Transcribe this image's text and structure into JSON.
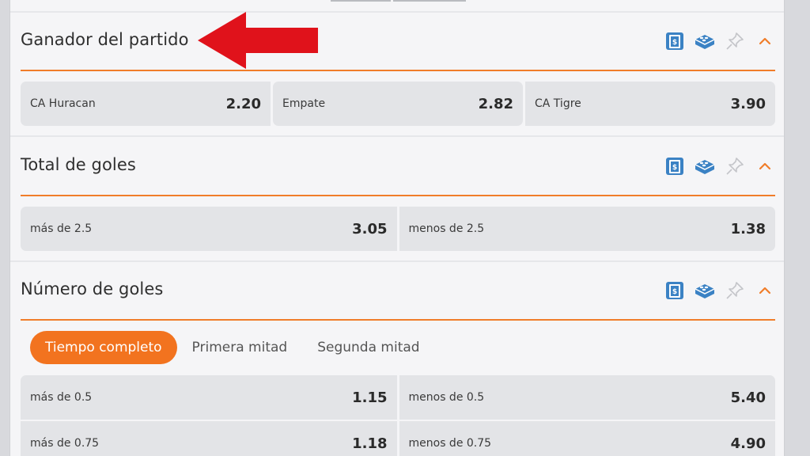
{
  "colors": {
    "accent": "#f07d2a",
    "tab_active_bg": "#f2731f",
    "icon_blue": "#3b82c4",
    "annotation_arrow": "#e0121b"
  },
  "markets": [
    {
      "title": "Ganador del partido",
      "icons": [
        "cashout-icon",
        "bet-builder-icon",
        "pin-icon",
        "chevron-up-icon"
      ],
      "rows": [
        [
          {
            "label": "CA Huracan",
            "value": "2.20"
          },
          {
            "label": "Empate",
            "value": "2.82"
          },
          {
            "label": "CA Tigre",
            "value": "3.90"
          }
        ]
      ]
    },
    {
      "title": "Total de goles",
      "icons": [
        "cashout-icon",
        "bet-builder-icon",
        "pin-icon",
        "chevron-up-icon"
      ],
      "rows": [
        [
          {
            "label": "más de 2.5",
            "value": "3.05"
          },
          {
            "label": "menos de 2.5",
            "value": "1.38"
          }
        ]
      ]
    },
    {
      "title": "Número de goles",
      "icons": [
        "cashout-icon",
        "bet-builder-icon",
        "pin-icon",
        "chevron-up-icon"
      ],
      "tabs": [
        {
          "label": "Tiempo completo",
          "active": true
        },
        {
          "label": "Primera mitad",
          "active": false
        },
        {
          "label": "Segunda mitad",
          "active": false
        }
      ],
      "rows": [
        [
          {
            "label": "más de 0.5",
            "value": "1.15"
          },
          {
            "label": "menos de 0.5",
            "value": "5.40"
          }
        ],
        [
          {
            "label": "más de 0.75",
            "value": "1.18"
          },
          {
            "label": "menos de 0.75",
            "value": "4.90"
          }
        ]
      ]
    }
  ]
}
